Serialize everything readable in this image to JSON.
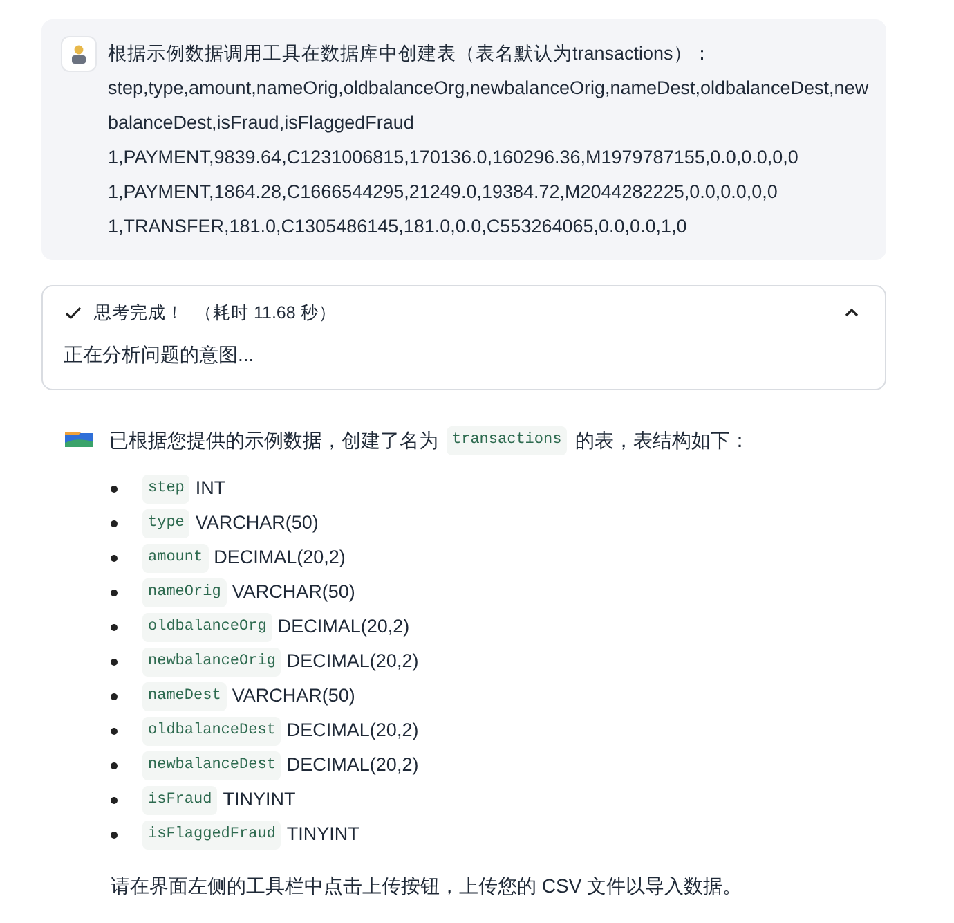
{
  "user_message": {
    "lines": [
      "根据示例数据调用工具在数据库中创建表（表名默认为transactions）：",
      "step,type,amount,nameOrig,oldbalanceOrg,newbalanceOrig,nameDest,oldbalanceDest,newbalanceDest,isFraud,isFlaggedFraud",
      "1,PAYMENT,9839.64,C1231006815,170136.0,160296.36,M1979787155,0.0,0.0,0,0",
      "1,PAYMENT,1864.28,C1666544295,21249.0,19384.72,M2044282225,0.0,0.0,0,0",
      "1,TRANSFER,181.0,C1305486145,181.0,0.0,C553264065,0.0,0.0,1,0"
    ]
  },
  "thinking": {
    "status": "思考完成！",
    "duration": "（耗时 11.68 秒）",
    "expanded": true,
    "content": "正在分析问题的意图..."
  },
  "response": {
    "intro_before": "已根据您提供的示例数据，创建了名为",
    "intro_code": "transactions",
    "intro_after": "的表，表结构如下：",
    "columns": [
      {
        "name": "step",
        "type": "INT"
      },
      {
        "name": "type",
        "type": "VARCHAR(50)"
      },
      {
        "name": "amount",
        "type": "DECIMAL(20,2)"
      },
      {
        "name": "nameOrig",
        "type": "VARCHAR(50)"
      },
      {
        "name": "oldbalanceOrg",
        "type": "DECIMAL(20,2)"
      },
      {
        "name": "newbalanceOrig",
        "type": "DECIMAL(20,2)"
      },
      {
        "name": "nameDest",
        "type": "VARCHAR(50)"
      },
      {
        "name": "oldbalanceDest",
        "type": "DECIMAL(20,2)"
      },
      {
        "name": "newbalanceDest",
        "type": "DECIMAL(20,2)"
      },
      {
        "name": "isFraud",
        "type": "TINYINT"
      },
      {
        "name": "isFlaggedFraud",
        "type": "TINYINT"
      }
    ],
    "footer": "请在界面左侧的工具栏中点击上传按钮，上传您的 CSV 文件以导入数据。"
  }
}
